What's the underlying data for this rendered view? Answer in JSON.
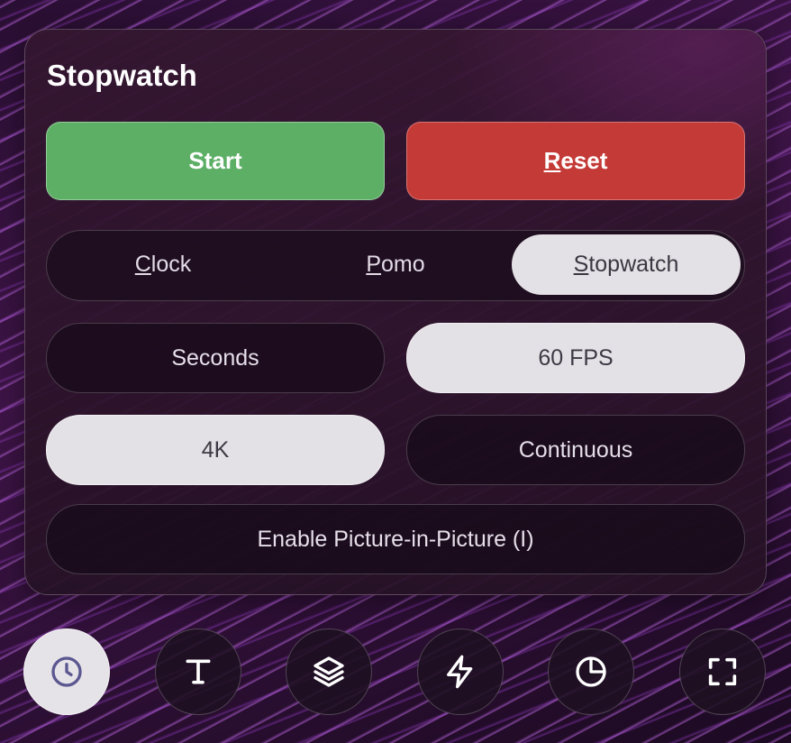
{
  "panel": {
    "title": "Stopwatch",
    "start_label": "Start",
    "reset_label_first": "R",
    "reset_label_rest": "eset"
  },
  "modes": [
    {
      "first": "C",
      "rest": "lock",
      "selected": false
    },
    {
      "first": "P",
      "rest": "omo",
      "selected": false
    },
    {
      "first": "S",
      "rest": "topwatch",
      "selected": true
    }
  ],
  "options": {
    "seconds_label": "Seconds",
    "fps_label": "60 FPS",
    "resolution_label": "4K",
    "continuous_label": "Continuous",
    "pip_label": "Enable Picture-in-Picture (I)"
  },
  "dock": [
    {
      "icon": "clock-icon",
      "active": true
    },
    {
      "icon": "text-icon",
      "active": false
    },
    {
      "icon": "layers-icon",
      "active": false
    },
    {
      "icon": "lightning-icon",
      "active": false
    },
    {
      "icon": "pie-chart-icon",
      "active": false
    },
    {
      "icon": "fullscreen-icon",
      "active": false
    }
  ],
  "colors": {
    "start": "#5daf66",
    "reset": "#c43a37",
    "selected": "#e4e1e6",
    "active_icon": "#5b5790"
  }
}
